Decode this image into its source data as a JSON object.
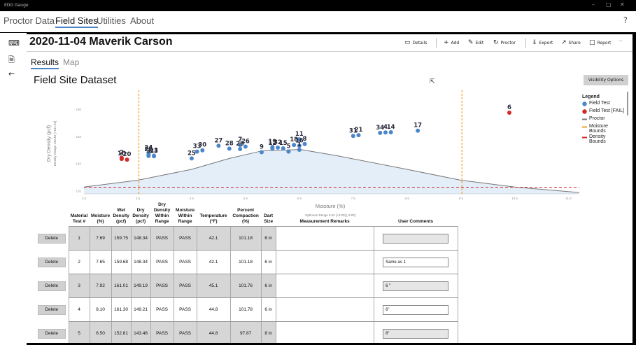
{
  "titlebar": {
    "app_title": "EDG Gauge",
    "minimize": "–",
    "maximize": "□",
    "close": "✕"
  },
  "nav": {
    "tabs": [
      "Proctor Data",
      "Field Sites",
      "Utilities",
      "About"
    ],
    "active": "Field Sites",
    "help": "?"
  },
  "header": {
    "title": "2020-11-04 Maverik Carson"
  },
  "toolbar": {
    "details": "Details",
    "add": "Add",
    "edit": "Edit",
    "proctor": "Proctor",
    "export": "Export",
    "share": "Share",
    "report": "Report",
    "more": "···"
  },
  "subtabs": [
    "Results",
    "Map"
  ],
  "dataset_title": "Field Site Dataset",
  "visibility_button": "Visibility Options",
  "legend": {
    "title": "Legend",
    "items": [
      {
        "label": "Field Test",
        "color": "#4b86c9"
      },
      {
        "label": "Field Test [FAIL]",
        "color": "#d12a2a"
      },
      {
        "label": "Proctor",
        "color": "#777777"
      },
      {
        "label": "Moisture Bounds",
        "color": "#f0a020"
      },
      {
        "label": "Density Bounds",
        "color": "#d12a2a"
      }
    ]
  },
  "chart_data": {
    "type": "scatter",
    "xlabel": "Moisture (%)",
    "ylabel": "Dry Density (pcf)",
    "ylabel2": "Density Range 140.40 [>131.94]",
    "footnote": "Optimum Range 6.52 [+3.00] [-3.00]",
    "x_ticks": [
      "2.5",
      "3.5",
      "4.5",
      "5.5",
      "6.5",
      "7.5",
      "8.5",
      "9.5",
      "10.5",
      "11.5"
    ],
    "y_ticks": [
      "120",
      "140",
      "160",
      "180"
    ],
    "xlim": [
      2.5,
      11.7
    ],
    "ylim": [
      118,
      192
    ],
    "moisture_bounds": [
      3.52,
      9.52
    ],
    "density_bound": 122.9,
    "proctor_curve": [
      [
        2.5,
        123
      ],
      [
        3.5,
        128
      ],
      [
        4.5,
        136
      ],
      [
        5.2,
        144
      ],
      [
        5.8,
        149.5
      ],
      [
        6.52,
        150.6
      ],
      [
        7.2,
        146
      ],
      [
        8.5,
        136
      ],
      [
        9.5,
        128
      ],
      [
        10.5,
        123
      ],
      [
        11.7,
        119
      ]
    ],
    "points": [
      {
        "label": "1",
        "x": 6.5,
        "y": 150.4,
        "fail": false
      },
      {
        "label": "2",
        "x": 3.2,
        "y": 144.5,
        "fail": true
      },
      {
        "label": "3",
        "x": 3.7,
        "y": 145.8,
        "fail": false
      },
      {
        "label": "4",
        "x": 8.1,
        "y": 163.1,
        "fail": false
      },
      {
        "label": "5",
        "x": 6.3,
        "y": 149.0,
        "fail": false
      },
      {
        "label": "6",
        "x": 10.4,
        "y": 177.6,
        "fail": true
      },
      {
        "label": "7",
        "x": 5.4,
        "y": 153.9,
        "fail": false
      },
      {
        "label": "8",
        "x": 6.6,
        "y": 154.6,
        "fail": false
      },
      {
        "label": "9",
        "x": 5.8,
        "y": 148.6,
        "fail": false
      },
      {
        "label": "10",
        "x": 3.2,
        "y": 143.6,
        "fail": true
      },
      {
        "label": "11",
        "x": 6.5,
        "y": 158.0,
        "fail": false
      },
      {
        "label": "12",
        "x": 6.0,
        "y": 151.3,
        "fail": false
      },
      {
        "label": "13",
        "x": 3.8,
        "y": 146.0,
        "fail": false
      },
      {
        "label": "14",
        "x": 8.2,
        "y": 163.2,
        "fail": false
      },
      {
        "label": "15",
        "x": 6.2,
        "y": 151.4,
        "fail": false
      },
      {
        "label": "16",
        "x": 6.5,
        "y": 153.3,
        "fail": false
      },
      {
        "label": "17",
        "x": 8.7,
        "y": 164.4,
        "fail": false
      },
      {
        "label": "18",
        "x": 6.4,
        "y": 153.9,
        "fail": false
      },
      {
        "label": "19",
        "x": 6.0,
        "y": 152.4,
        "fail": false
      },
      {
        "label": "20",
        "x": 3.3,
        "y": 143.1,
        "fail": true
      },
      {
        "label": "21",
        "x": 7.6,
        "y": 161.1,
        "fail": false
      },
      {
        "label": "22",
        "x": 3.7,
        "y": 146.9,
        "fail": false
      },
      {
        "label": "23",
        "x": 3.8,
        "y": 145.6,
        "fail": false
      },
      {
        "label": "24",
        "x": 3.7,
        "y": 148.1,
        "fail": false
      },
      {
        "label": "25",
        "x": 4.5,
        "y": 144.0,
        "fail": false
      },
      {
        "label": "26",
        "x": 5.5,
        "y": 152.7,
        "fail": false
      },
      {
        "label": "27",
        "x": 5.0,
        "y": 153.3,
        "fail": false
      },
      {
        "label": "28",
        "x": 5.2,
        "y": 151.2,
        "fail": false
      },
      {
        "label": "29",
        "x": 5.4,
        "y": 150.9,
        "fail": false
      },
      {
        "label": "30",
        "x": 4.7,
        "y": 150.0,
        "fail": false
      },
      {
        "label": "31",
        "x": 7.5,
        "y": 160.5,
        "fail": false
      },
      {
        "label": "32",
        "x": 6.1,
        "y": 152.0,
        "fail": false
      },
      {
        "label": "33",
        "x": 4.6,
        "y": 149.0,
        "fail": false
      },
      {
        "label": "34",
        "x": 8.0,
        "y": 162.8,
        "fail": false
      }
    ]
  },
  "table": {
    "headers": [
      "Material Test #",
      "Moisture (%)",
      "Wet Density (pcf)",
      "Dry Density (pcf)",
      "Dry Density Within Range",
      "Moisture Within Range",
      "Temperature (°F)",
      "Percent Compaction (%)",
      "Dart Size",
      "Measurement Remarks",
      "User Comments"
    ],
    "delete_label": "Delete",
    "rows": [
      {
        "test": "1",
        "moisture": "7.69",
        "wet": "159.75",
        "dry": "148.34",
        "dd_range": "PASS",
        "m_range": "PASS",
        "temp": "42.1",
        "pct": "101.18",
        "dart": "6 in",
        "remarks": "",
        "comments": ""
      },
      {
        "test": "2",
        "moisture": "7.65",
        "wet": "159.68",
        "dry": "148.34",
        "dd_range": "PASS",
        "m_range": "PASS",
        "temp": "42.1",
        "pct": "101.18",
        "dart": "6 in",
        "remarks": "",
        "comments": "Same as 1"
      },
      {
        "test": "3",
        "moisture": "7.92",
        "wet": "161.01",
        "dry": "149.19",
        "dd_range": "PASS",
        "m_range": "PASS",
        "temp": "45.1",
        "pct": "101.76",
        "dart": "6 in",
        "remarks": "",
        "comments": "6 \""
      },
      {
        "test": "4",
        "moisture": "8.10",
        "wet": "161.30",
        "dry": "149.21",
        "dd_range": "PASS",
        "m_range": "PASS",
        "temp": "44.8",
        "pct": "101.78",
        "dart": "6 in",
        "remarks": "",
        "comments": "6\""
      },
      {
        "test": "5",
        "moisture": "6.50",
        "wet": "152.81",
        "dry": "143.48",
        "dd_range": "PASS",
        "m_range": "PASS",
        "temp": "44.8",
        "pct": "97.87",
        "dart": "8 in",
        "remarks": "",
        "comments": "8\""
      }
    ]
  }
}
